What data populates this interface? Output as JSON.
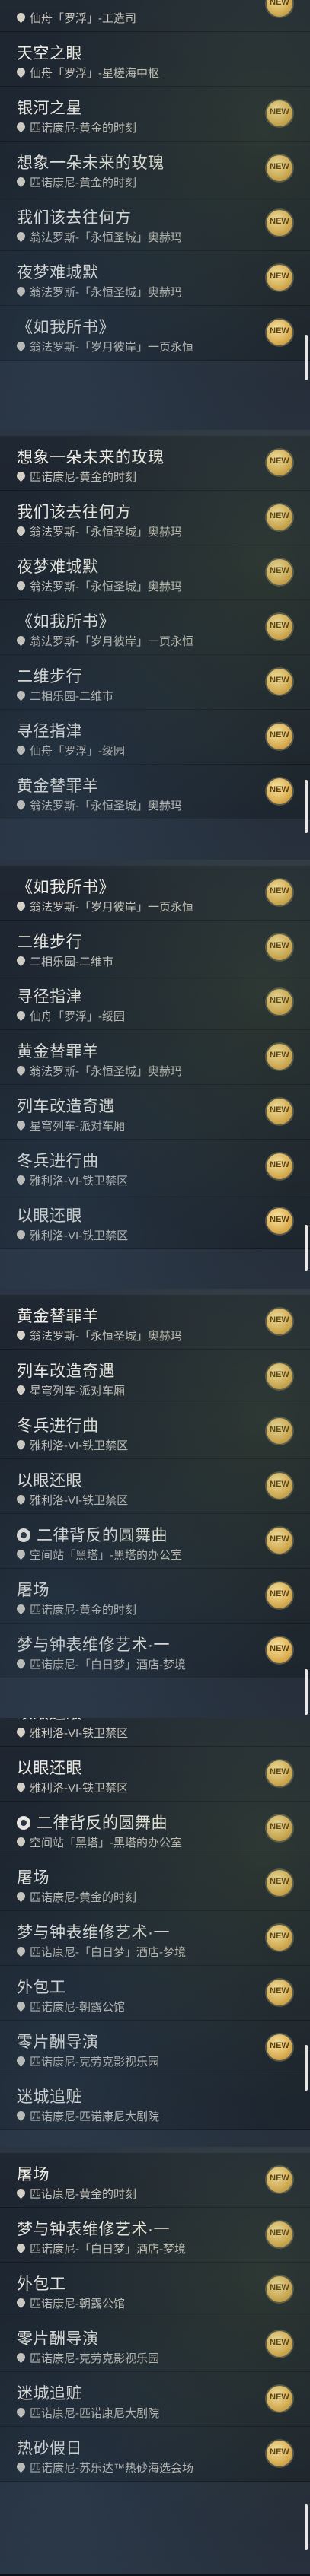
{
  "badge_label": "NEW",
  "songs": {
    "xianzhou_gongsi": {
      "title": "",
      "location": "仙舟「罗浮」-工造司"
    },
    "tiankong": {
      "title": "天空之眼",
      "location": "仙舟「罗浮」-星槎海中枢"
    },
    "yinhe": {
      "title": "银河之星",
      "location": "匹诺康尼-黄金的时刻"
    },
    "xiang": {
      "title": "想象一朵未来的玫瑰",
      "location": "匹诺康尼-黄金的时刻"
    },
    "women": {
      "title": "我们该去往何方",
      "location": "翁法罗斯-「永恒圣城」奥赫玛"
    },
    "yemeng": {
      "title": "夜梦难城默",
      "location": "翁法罗斯-「永恒圣城」奥赫玛"
    },
    "rusuo": {
      "title": "《如我所书》",
      "location": "翁法罗斯-「岁月彼岸」一页永恒"
    },
    "erwei": {
      "title": "二维步行",
      "location": "二相乐园-二维市"
    },
    "xunxun": {
      "title": "寻径指津",
      "location": "仙舟「罗浮」-绥园"
    },
    "huangjin": {
      "title": "黄金替罪羊",
      "location": "翁法罗斯-「永恒圣城」奥赫玛"
    },
    "lieche": {
      "title": "列车改造奇遇",
      "location": "星穹列车-派对车厢"
    },
    "dongbing": {
      "title": "冬兵进行曲",
      "location": "雅利洛-VI-铁卫禁区"
    },
    "yiyan": {
      "title": "以眼还眼",
      "location": "雅利洛-VI-铁卫禁区"
    },
    "erlv": {
      "title": "二律背反的圆舞曲",
      "location": "空间站「黑塔」-黑塔的办公室"
    },
    "tuchang": {
      "title": "屠场",
      "location": "匹诺康尼-黄金的时刻"
    },
    "mengyu": {
      "title": "梦与钟表维修艺术·一",
      "location": "匹诺康尼-「白日梦」酒店-梦境"
    },
    "waibao": {
      "title": "外包工",
      "location": "匹诺康尼-朝露公馆"
    },
    "lingpian": {
      "title": "零片酬导演",
      "location": "匹诺康尼-克劳克影视乐园"
    },
    "micheng": {
      "title": "迷城追赃",
      "location": "匹诺康尼-匹诺康尼大剧院"
    },
    "relao": {
      "title": "热砂假日",
      "location": "匹诺康尼-苏乐达™热砂海选会场"
    }
  },
  "panels": [
    {
      "rows": [
        {
          "song": "xianzhou_gongsi",
          "badge": true,
          "highlight": false
        },
        {
          "song": "tiankong",
          "badge": false,
          "highlight": false
        },
        {
          "song": "yinhe",
          "badge": true,
          "highlight": false
        },
        {
          "song": "xiang",
          "badge": true,
          "highlight": false
        },
        {
          "song": "women",
          "badge": true,
          "highlight": false
        },
        {
          "song": "yemeng",
          "badge": true,
          "highlight": false
        },
        {
          "song": "rusuo",
          "badge": true,
          "highlight": false
        }
      ]
    },
    {
      "rows": [
        {
          "song": "xiang",
          "badge": true,
          "highlight": false
        },
        {
          "song": "women",
          "badge": true,
          "highlight": false
        },
        {
          "song": "yemeng",
          "badge": true,
          "highlight": false
        },
        {
          "song": "rusuo",
          "badge": true,
          "highlight": false
        },
        {
          "song": "erwei",
          "badge": true,
          "highlight": false
        },
        {
          "song": "xunxun",
          "badge": true,
          "highlight": false
        },
        {
          "song": "huangjin",
          "badge": true,
          "highlight": false
        }
      ]
    },
    {
      "rows": [
        {
          "song": "rusuo",
          "badge": true,
          "highlight": false
        },
        {
          "song": "erwei",
          "badge": true,
          "highlight": false
        },
        {
          "song": "xunxun",
          "badge": true,
          "highlight": false
        },
        {
          "song": "huangjin",
          "badge": true,
          "highlight": false
        },
        {
          "song": "lieche",
          "badge": true,
          "highlight": false
        },
        {
          "song": "dongbing",
          "badge": true,
          "highlight": false
        },
        {
          "song": "yiyan",
          "badge": true,
          "highlight": false
        }
      ]
    },
    {
      "rows": [
        {
          "song": "huangjin",
          "badge": true,
          "highlight": false
        },
        {
          "song": "lieche",
          "badge": true,
          "highlight": false
        },
        {
          "song": "dongbing",
          "badge": true,
          "highlight": false
        },
        {
          "song": "yiyan",
          "badge": true,
          "highlight": false
        },
        {
          "song": "erlv",
          "badge": true,
          "highlight": false,
          "icon": true
        },
        {
          "song": "tuchang",
          "badge": true,
          "highlight": false
        },
        {
          "song": "mengyu",
          "badge": true,
          "highlight": false
        }
      ]
    },
    {
      "rows": [
        {
          "song": "yiyan",
          "badge": false,
          "highlight": false
        },
        {
          "song": "yiyan",
          "badge": true,
          "highlight": false
        },
        {
          "song": "erlv",
          "badge": true,
          "highlight": false,
          "icon": true
        },
        {
          "song": "tuchang",
          "badge": true,
          "highlight": false
        },
        {
          "song": "mengyu",
          "badge": true,
          "highlight": false
        },
        {
          "song": "waibao",
          "badge": true,
          "highlight": false
        },
        {
          "song": "lingpian",
          "badge": true,
          "highlight": false
        },
        {
          "song": "micheng",
          "badge": false,
          "highlight": false
        }
      ]
    },
    {
      "rows": [
        {
          "song": "tuchang",
          "badge": true,
          "highlight": false
        },
        {
          "song": "mengyu",
          "badge": true,
          "highlight": false
        },
        {
          "song": "waibao",
          "badge": true,
          "highlight": false
        },
        {
          "song": "lingpian",
          "badge": true,
          "highlight": false
        },
        {
          "song": "micheng",
          "badge": true,
          "highlight": false
        },
        {
          "song": "relao",
          "badge": true,
          "highlight": false
        }
      ]
    }
  ]
}
